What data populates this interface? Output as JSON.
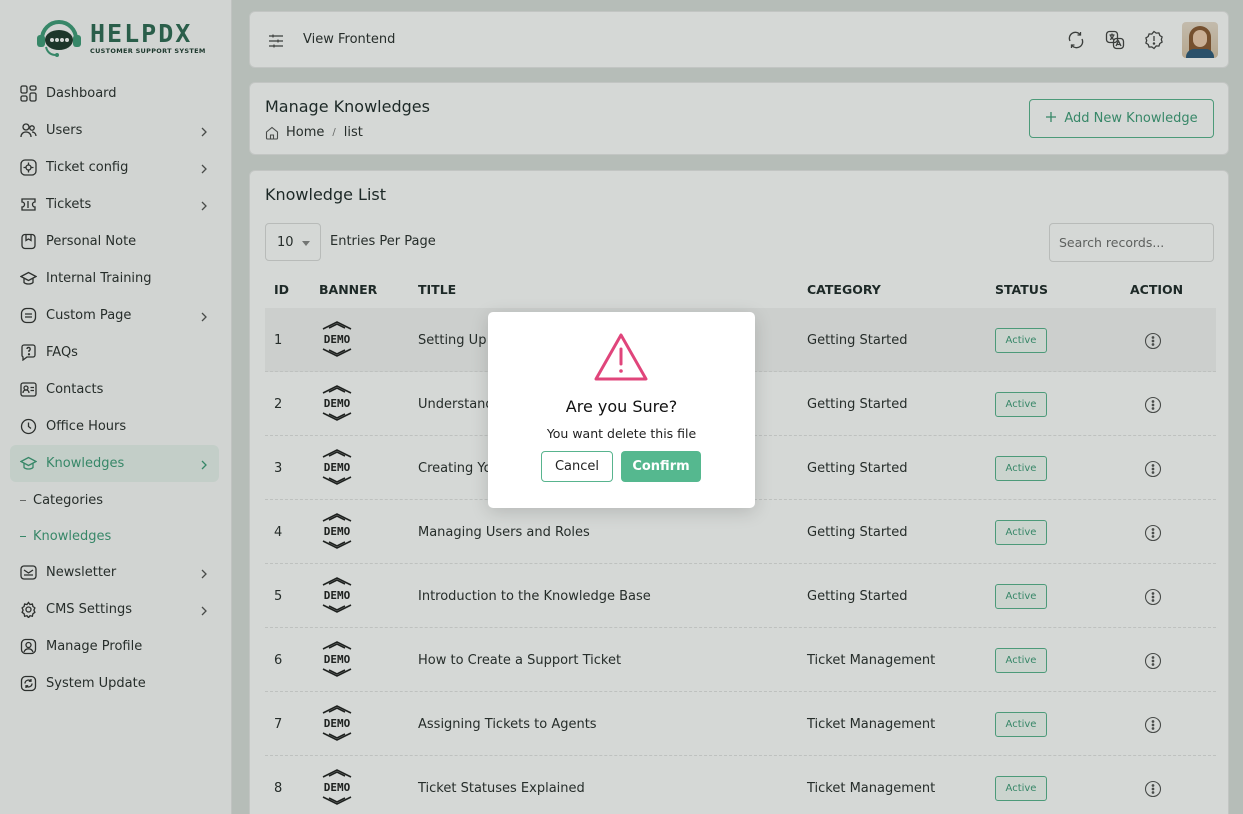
{
  "brand": {
    "name": "HELPDX",
    "tagline": "CUSTOMER SUPPORT SYSTEM",
    "accent_color": "#3f9d79"
  },
  "sidebar": {
    "items": [
      {
        "label": "Dashboard",
        "icon": "dashboard-icon",
        "has_children": false
      },
      {
        "label": "Users",
        "icon": "users-icon",
        "has_children": true
      },
      {
        "label": "Ticket config",
        "icon": "ticket-config-icon",
        "has_children": true
      },
      {
        "label": "Tickets",
        "icon": "tickets-icon",
        "has_children": true
      },
      {
        "label": "Personal Note",
        "icon": "note-icon",
        "has_children": false
      },
      {
        "label": "Internal Training",
        "icon": "training-icon",
        "has_children": false
      },
      {
        "label": "Custom Page",
        "icon": "page-icon",
        "has_children": true
      },
      {
        "label": "FAQs",
        "icon": "faq-icon",
        "has_children": false
      },
      {
        "label": "Contacts",
        "icon": "contacts-icon",
        "has_children": false
      },
      {
        "label": "Office Hours",
        "icon": "clock-icon",
        "has_children": false
      },
      {
        "label": "Knowledges",
        "icon": "knowledge-icon",
        "has_children": true,
        "active": true
      }
    ],
    "sub_items": [
      {
        "label": "Categories"
      },
      {
        "label": "Knowledges",
        "active": true
      }
    ],
    "items_after": [
      {
        "label": "Newsletter",
        "icon": "newsletter-icon",
        "has_children": true
      },
      {
        "label": "CMS Settings",
        "icon": "settings-icon",
        "has_children": true
      },
      {
        "label": "Manage Profile",
        "icon": "profile-icon",
        "has_children": false
      },
      {
        "label": "System Update",
        "icon": "update-icon",
        "has_children": false
      }
    ]
  },
  "topbar": {
    "view_frontend": "View Frontend"
  },
  "header": {
    "title": "Manage Knowledges",
    "breadcrumb": [
      "Home",
      "list"
    ],
    "add_button": "Add New Knowledge"
  },
  "list": {
    "title": "Knowledge List",
    "per_page_value": "10",
    "per_page_label": "Entries Per Page",
    "search_placeholder": "Search records...",
    "columns": [
      "ID",
      "BANNER",
      "TITLE",
      "CATEGORY",
      "STATUS",
      "ACTION"
    ],
    "banner_text": "DEMO",
    "rows": [
      {
        "id": "1",
        "title": "Setting Up Y",
        "category": "Getting Started",
        "status": "Active"
      },
      {
        "id": "2",
        "title": "Understand",
        "category": "Getting Started",
        "status": "Active"
      },
      {
        "id": "3",
        "title": "Creating Yo",
        "category": "Getting Started",
        "status": "Active"
      },
      {
        "id": "4",
        "title": "Managing Users and Roles",
        "category": "Getting Started",
        "status": "Active"
      },
      {
        "id": "5",
        "title": "Introduction to the Knowledge Base",
        "category": "Getting Started",
        "status": "Active"
      },
      {
        "id": "6",
        "title": "How to Create a Support Ticket",
        "category": "Ticket Management",
        "status": "Active"
      },
      {
        "id": "7",
        "title": "Assigning Tickets to Agents",
        "category": "Ticket Management",
        "status": "Active"
      },
      {
        "id": "8",
        "title": "Ticket Statuses Explained",
        "category": "Ticket Management",
        "status": "Active"
      }
    ]
  },
  "modal": {
    "title": "Are you Sure?",
    "message": "You want delete this file",
    "cancel": "Cancel",
    "confirm": "Confirm",
    "warning_color": "#e0457b"
  }
}
